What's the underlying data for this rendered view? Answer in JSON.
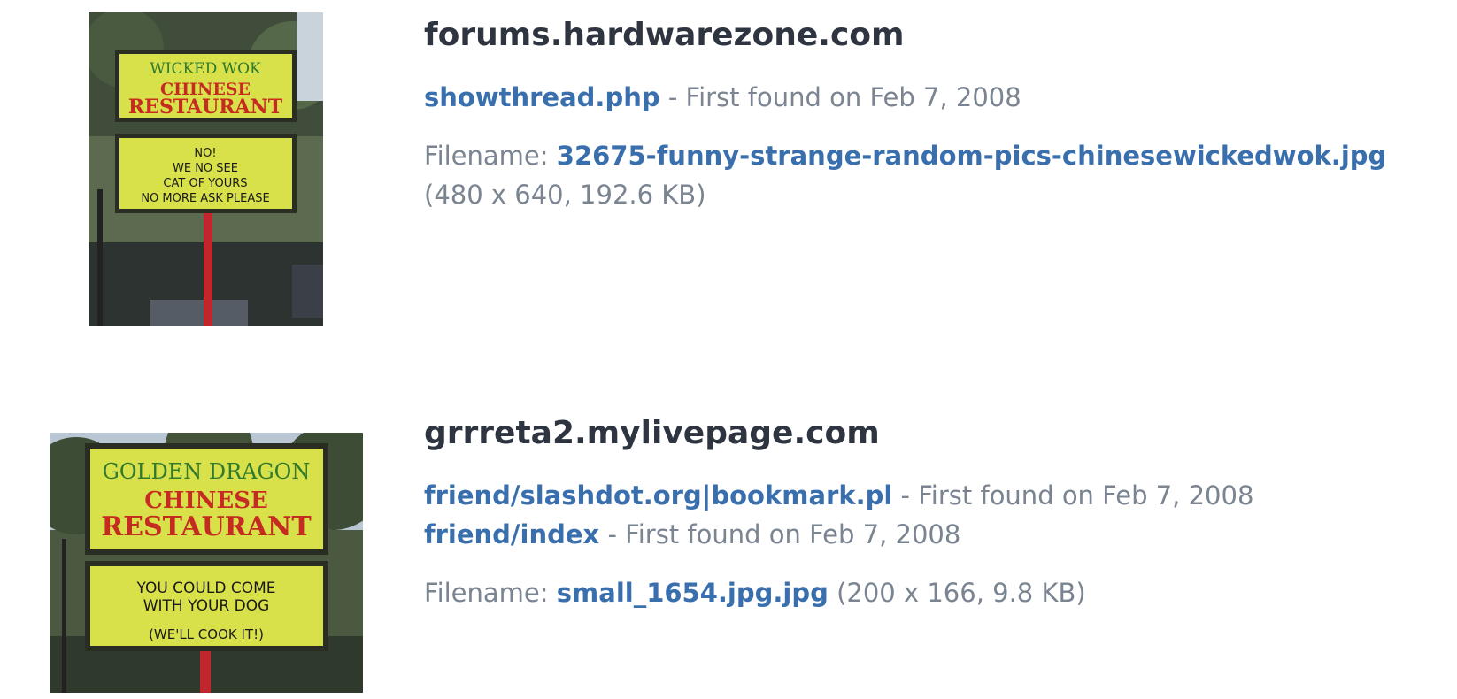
{
  "results": [
    {
      "domain": "forums.hardwarezone.com",
      "pages": [
        {
          "link": "showthread.php",
          "found": "- First found on Feb 7, 2008"
        }
      ],
      "filename_label": "Filename:",
      "filename": "32675-funny-strange-random-pics-chinesewickedwok.jpg",
      "file_meta": "(480 x 640, 192.6 KB)",
      "thumbnail": {
        "icon": "restaurant-sign-photo",
        "sign_top": [
          "WICKED WOK",
          "CHINESE",
          "RESTAURANT"
        ],
        "sign_bottom": [
          "NO!",
          "WE NO SEE",
          "CAT OF YOURS",
          "NO MORE ASK PLEASE"
        ]
      }
    },
    {
      "domain": "grrreta2.mylivepage.com",
      "pages": [
        {
          "link": "friend/slashdot.org|bookmark.pl",
          "found": "- First found on Feb 7, 2008"
        },
        {
          "link": "friend/index",
          "found": "- First found on Feb 7, 2008"
        }
      ],
      "filename_label": "Filename:",
      "filename": "small_1654.jpg.jpg",
      "file_meta": "(200 x 166, 9.8 KB)",
      "thumbnail": {
        "icon": "restaurant-sign-photo",
        "sign_top": [
          "GOLDEN DRAGON",
          "CHINESE",
          "RESTAURANT"
        ],
        "sign_bottom": [
          "YOU COULD COME",
          "WITH YOUR DOG",
          "(WE'LL COOK IT!)"
        ]
      }
    }
  ],
  "colors": {
    "link": "#3a6fae",
    "domain": "#2f3540",
    "muted": "#7b8491",
    "sign": "#d8e04a",
    "sign_red": "#c62b22",
    "sign_green": "#2f7a2e"
  }
}
